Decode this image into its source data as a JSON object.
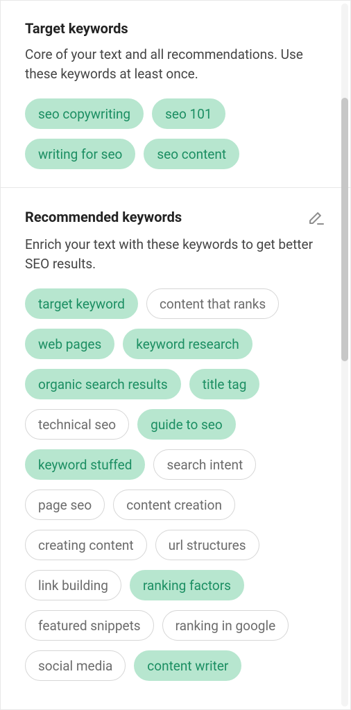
{
  "colors": {
    "pill_fill_bg": "#b7e6cf",
    "pill_fill_text": "#1b8e62",
    "pill_outline_border": "#d6d6d6",
    "pill_outline_text": "#6b6b6b"
  },
  "target": {
    "title": "Target keywords",
    "description": "Core of your text and all recommendations. Use these keywords at least once.",
    "keywords": [
      {
        "label": "seo copywriting",
        "state": "filled"
      },
      {
        "label": "seo 101",
        "state": "filled"
      },
      {
        "label": "writing for seo",
        "state": "filled"
      },
      {
        "label": "seo content",
        "state": "filled"
      }
    ]
  },
  "recommended": {
    "title": "Recommended keywords",
    "description": "Enrich your text with these keywords to get better SEO results.",
    "edit_icon": "pencil-icon",
    "keywords": [
      {
        "label": "target keyword",
        "state": "filled"
      },
      {
        "label": "content that ranks",
        "state": "outlined"
      },
      {
        "label": "web pages",
        "state": "filled"
      },
      {
        "label": "keyword research",
        "state": "filled"
      },
      {
        "label": "organic search results",
        "state": "filled"
      },
      {
        "label": "title tag",
        "state": "filled"
      },
      {
        "label": "technical seo",
        "state": "outlined"
      },
      {
        "label": "guide to seo",
        "state": "filled"
      },
      {
        "label": "keyword stuffed",
        "state": "filled"
      },
      {
        "label": "search intent",
        "state": "outlined"
      },
      {
        "label": "page seo",
        "state": "outlined"
      },
      {
        "label": "content creation",
        "state": "outlined"
      },
      {
        "label": "creating content",
        "state": "outlined"
      },
      {
        "label": "url structures",
        "state": "outlined"
      },
      {
        "label": "link building",
        "state": "outlined"
      },
      {
        "label": "ranking factors",
        "state": "filled"
      },
      {
        "label": "featured snippets",
        "state": "outlined"
      },
      {
        "label": "ranking in google",
        "state": "outlined"
      },
      {
        "label": "social media",
        "state": "outlined"
      },
      {
        "label": "content writer",
        "state": "filled"
      }
    ]
  }
}
